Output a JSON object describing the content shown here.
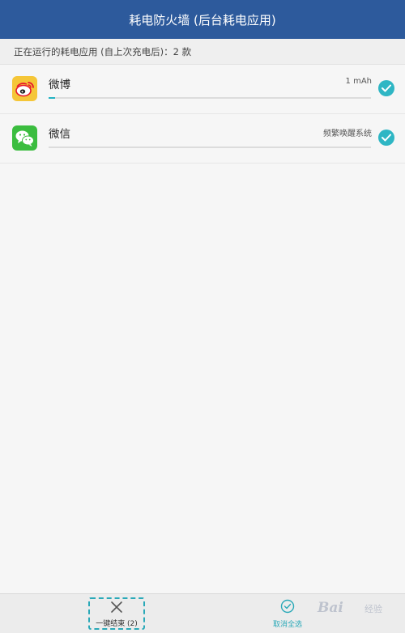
{
  "header": {
    "title": "耗电防火墙 (后台耗电应用)"
  },
  "subheader": {
    "text": "正在运行的耗电应用 (自上次充电后)：2 款"
  },
  "apps": [
    {
      "name": "微博",
      "info": "1 mAh",
      "usage_fraction": 0.02,
      "checked": true,
      "icon": "weibo-icon"
    },
    {
      "name": "微信",
      "info": "频繁唤醒系统",
      "usage_fraction": 0.0,
      "checked": true,
      "icon": "wechat-icon"
    }
  ],
  "bottom": {
    "end_all_label": "一键结束 (2)",
    "deselect_label": "取消全选"
  },
  "watermark": {
    "text": "Bai",
    "sub": "经验"
  },
  "colors": {
    "header": "#2d5a9c",
    "accent": "#2fb6c4"
  }
}
